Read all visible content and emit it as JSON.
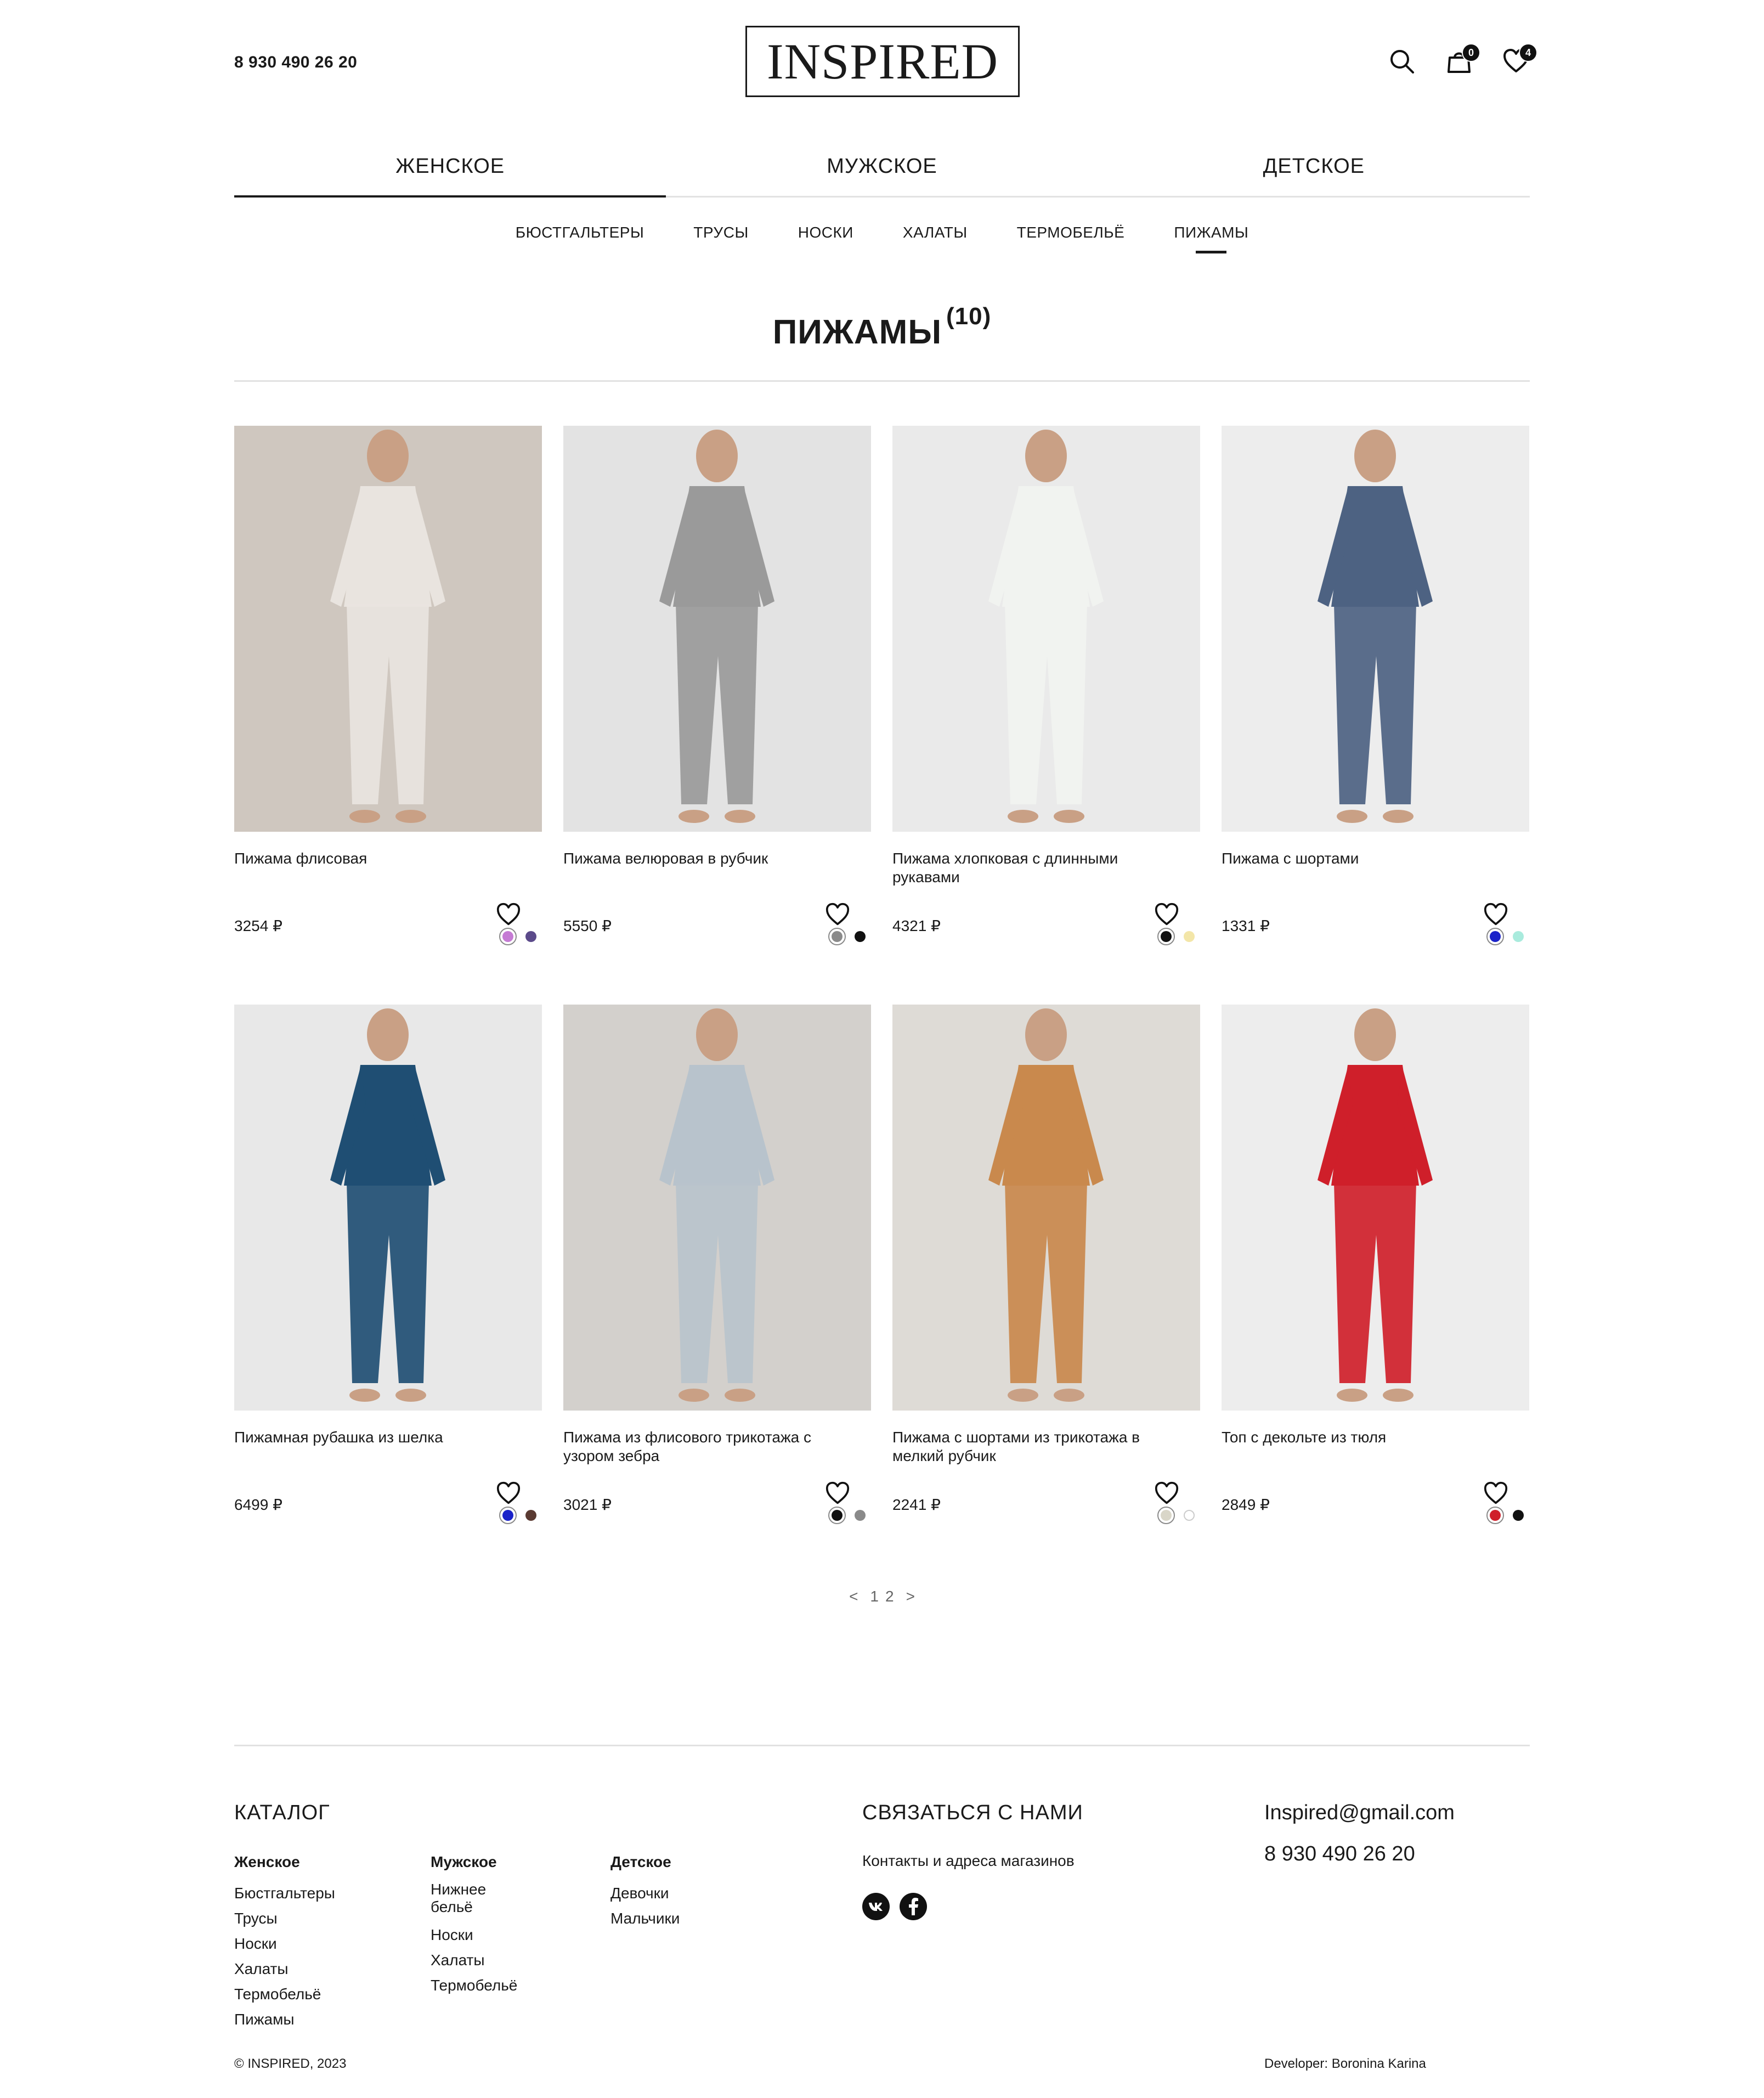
{
  "header": {
    "phone": "8 930 490 26 20",
    "logo": "INSPIRED",
    "cart_count": "0",
    "favorites_count": "4"
  },
  "main_nav": [
    {
      "label": "ЖЕНСКОЕ",
      "active": true
    },
    {
      "label": "МУЖСКОЕ",
      "active": false
    },
    {
      "label": "ДЕТСКОЕ",
      "active": false
    }
  ],
  "sub_nav": [
    {
      "label": "БЮСТГАЛЬТЕРЫ",
      "active": false
    },
    {
      "label": "ТРУСЫ",
      "active": false
    },
    {
      "label": "НОСКИ",
      "active": false
    },
    {
      "label": "ХАЛАТЫ",
      "active": false
    },
    {
      "label": "ТЕРМОБЕЛЬЁ",
      "active": false
    },
    {
      "label": "ПИЖАМЫ",
      "active": true
    }
  ],
  "page": {
    "title": "ПИЖАМЫ",
    "count": "(10)"
  },
  "products": [
    {
      "name": "Пижама флисовая",
      "price": "3254 ₽",
      "bg": "#cfc7bf",
      "garment": "#e9e4df",
      "colors": [
        "#c57bd4",
        "#5b4a8a"
      ]
    },
    {
      "name": "Пижама велюровая в рубчик",
      "price": "5550 ₽",
      "bg": "#e3e3e3",
      "garment": "#9a9a9a",
      "colors": [
        "#8a8a8a",
        "#111111"
      ]
    },
    {
      "name": "Пижама хлопковая с длинными рукавами",
      "price": "4321 ₽",
      "bg": "#eaeaea",
      "garment": "#f1f3f0",
      "colors": [
        "#111111",
        "#f3e6a8"
      ]
    },
    {
      "name": "Пижама с шортами",
      "price": "1331 ₽",
      "bg": "#ededed",
      "garment": "#4d6282",
      "colors": [
        "#1a22c9",
        "#a9ebdd"
      ]
    },
    {
      "name": "Пижамная рубашка из шелка",
      "price": "6499 ₽",
      "bg": "#e8e8e8",
      "garment": "#1f4e73",
      "colors": [
        "#1a22c9",
        "#5a3a32"
      ]
    },
    {
      "name": "Пижама из флисового трикотажа с узором зебра",
      "price": "3021 ₽",
      "bg": "#d3d0cc",
      "garment": "#b8c3cc",
      "colors": [
        "#111111",
        "#8a8a8a"
      ]
    },
    {
      "name": "Пижама с шортами из трикотажа в мелкий рубчик",
      "price": "2241 ₽",
      "bg": "#dedbd6",
      "garment": "#c9894d",
      "colors": [
        "#d9d6c8",
        "#ffffff"
      ]
    },
    {
      "name": "Топ с декольте из тюля",
      "price": "2849 ₽",
      "bg": "#ededed",
      "garment": "#cf1f2a",
      "colors": [
        "#cf1f2a",
        "#111111"
      ]
    }
  ],
  "pagination": {
    "prev": "<",
    "pages": [
      "1",
      "2"
    ],
    "next": ">"
  },
  "footer": {
    "catalog_title": "КАТАЛОГ",
    "columns": [
      {
        "heading": "Женское",
        "links": [
          "Бюстгальтеры",
          "Трусы",
          "Носки",
          "Халаты",
          "Термобельё",
          "Пижамы"
        ]
      },
      {
        "heading": "Мужское",
        "links": [
          "Нижнее бельё",
          "Носки",
          "Халаты",
          "Термобельё"
        ]
      },
      {
        "heading": "Детское",
        "links": [
          "Девочки",
          "Мальчики"
        ]
      }
    ],
    "contact_title": "СВЯЗАТЬСЯ С НАМИ",
    "contacts_link": "Контакты и адреса магазинов",
    "email": "Inspired@gmail.com",
    "phone": "8 930 490 26 20",
    "copyright": "© INSPIRED, 2023",
    "developer": "Developer: Boronina Karina"
  }
}
